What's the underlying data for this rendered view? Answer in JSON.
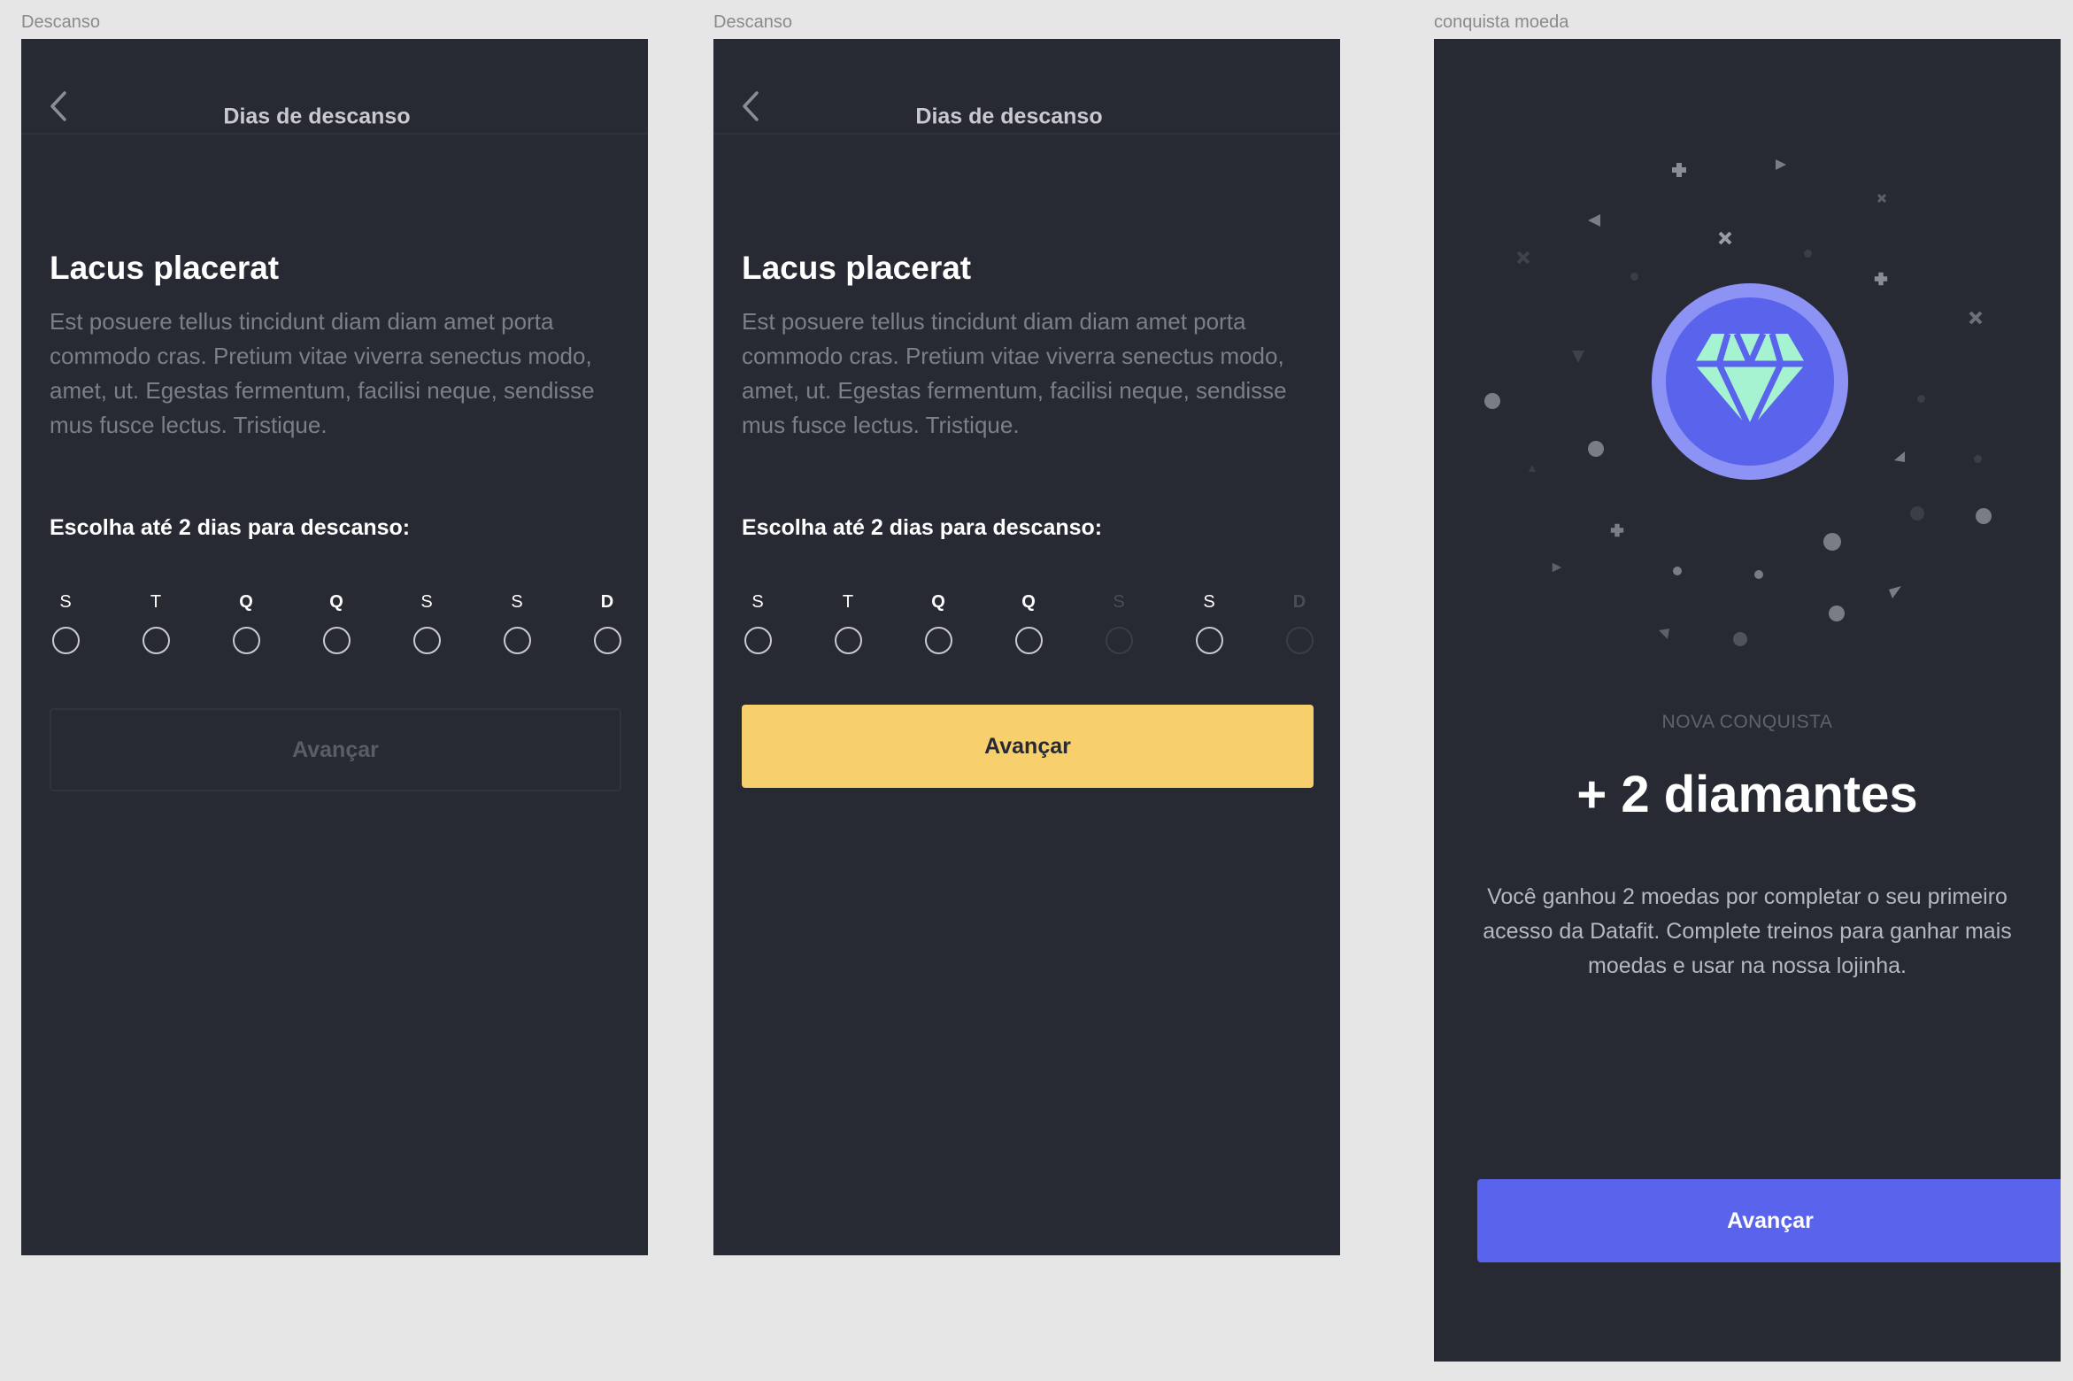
{
  "frames": [
    {
      "label": "Descanso",
      "header_title": "Dias de descanso",
      "title": "Lacus placerat",
      "description": "Est posuere tellus tincidunt diam diam amet porta commodo cras. Pretium vitae viverra senectus modo, amet, ut. Egestas fermentum, facilisi neque, sendisse mus fusce lectus. Tristique.",
      "prompt": "Escolha até 2 dias para descanso:",
      "days": [
        "S",
        "T",
        "Q",
        "Q",
        "S",
        "S",
        "D"
      ],
      "button_label": "Avançar"
    },
    {
      "label": "Descanso",
      "header_title": "Dias de descanso",
      "title": "Lacus placerat",
      "description": "Est posuere tellus tincidunt diam diam amet porta commodo cras. Pretium vitae viverra senectus modo, amet, ut. Egestas fermentum, facilisi neque, sendisse mus fusce lectus. Tristique.",
      "prompt": "Escolha até 2 dias para descanso:",
      "days": [
        "S",
        "T",
        "Q",
        "Q",
        "S",
        "S",
        "D"
      ],
      "disabled_days": [
        4,
        6
      ],
      "button_label": "Avançar"
    },
    {
      "label": "conquista moeda",
      "kicker": "NOVA CONQUISTA",
      "title": "+ 2 diamantes",
      "description": "Você ganhou 2 moedas por completar o seu primeiro acesso da Datafit. Complete treinos para ganhar mais moedas e usar na nossa lojinha.",
      "button_label": "Avançar",
      "badge_icon": "diamond-icon"
    }
  ],
  "colors": {
    "background": "#e6e6e6",
    "screen": "#272a33",
    "yellow_button": "#f7cf6c",
    "blue_button": "#5a63ec",
    "badge_ring": "#8d92f5",
    "diamond": "#a6f3d2"
  }
}
